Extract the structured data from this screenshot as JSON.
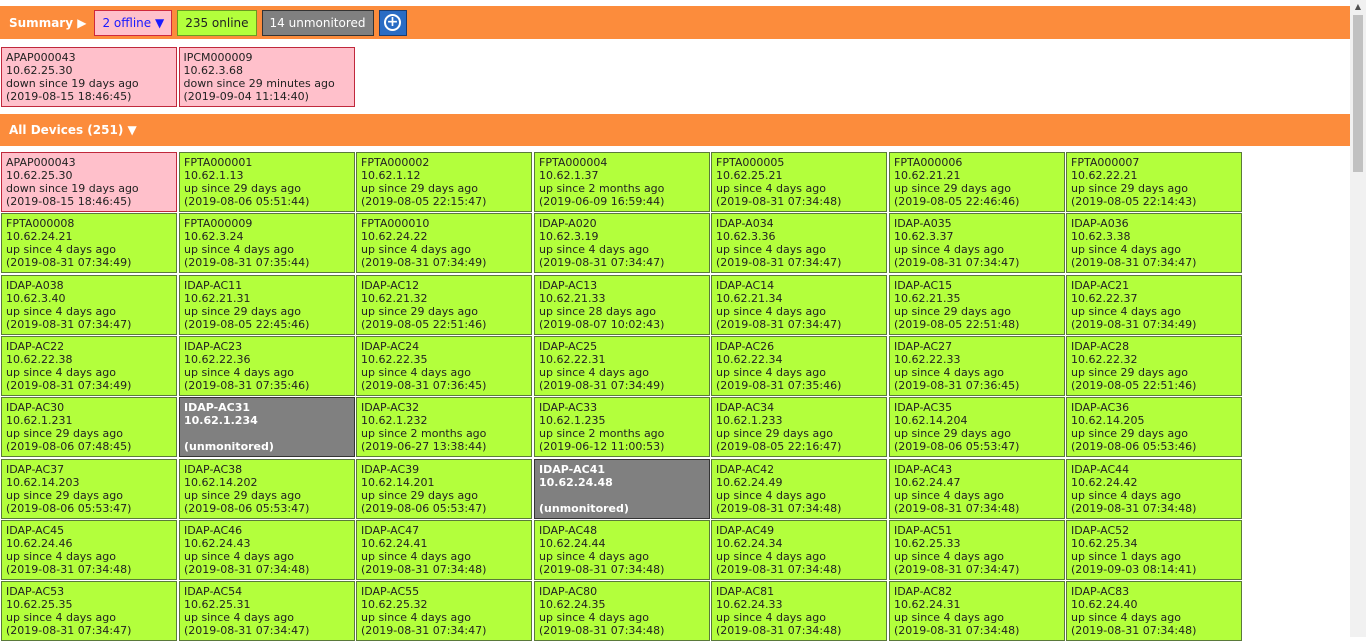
{
  "summary": {
    "title": "Summary ▶",
    "offline_label": "2 offline ▼",
    "online_label": "235 online",
    "unmonitored_label": "14 unmonitored",
    "add_symbol": "+"
  },
  "offline_devices": [
    {
      "name": "APAP000043",
      "ip": "10.62.25.30",
      "status": "down since 19 days ago",
      "since": "(2019-08-15 18:46:45)"
    },
    {
      "name": "IPCM000009",
      "ip": "10.62.3.68",
      "status": "down since 29 minutes ago",
      "since": "(2019-09-04 11:14:40)"
    }
  ],
  "all_devices_title": "All Devices (251) ▼",
  "colors": {
    "header_bar": "#fc8c3c",
    "online": "#b3ff3c",
    "offline": "#ffc0cb",
    "unmonitored": "#808080",
    "add_button": "#2a6cc4"
  },
  "devices": [
    {
      "state": "offline",
      "name": "APAP000043",
      "ip": "10.62.25.30",
      "status": "down since 19 days ago",
      "since": "(2019-08-15 18:46:45)"
    },
    {
      "state": "online",
      "name": "FPTA000001",
      "ip": "10.62.1.13",
      "status": "up since 29 days ago",
      "since": "(2019-08-06 05:51:44)"
    },
    {
      "state": "online",
      "name": "FPTA000002",
      "ip": "10.62.1.12",
      "status": "up since 29 days ago",
      "since": "(2019-08-05 22:15:47)"
    },
    {
      "state": "online",
      "name": "FPTA000004",
      "ip": "10.62.1.37",
      "status": "up since 2 months ago",
      "since": "(2019-06-09 16:59:44)"
    },
    {
      "state": "online",
      "name": "FPTA000005",
      "ip": "10.62.25.21",
      "status": "up since 4 days ago",
      "since": "(2019-08-31 07:34:48)"
    },
    {
      "state": "online",
      "name": "FPTA000006",
      "ip": "10.62.21.21",
      "status": "up since 29 days ago",
      "since": "(2019-08-05 22:46:46)"
    },
    {
      "state": "online",
      "name": "FPTA000007",
      "ip": "10.62.22.21",
      "status": "up since 29 days ago",
      "since": "(2019-08-05 22:14:43)"
    },
    {
      "state": "online",
      "name": "FPTA000008",
      "ip": "10.62.24.21",
      "status": "up since 4 days ago",
      "since": "(2019-08-31 07:34:49)"
    },
    {
      "state": "online",
      "name": "FPTA000009",
      "ip": "10.62.3.24",
      "status": "up since 4 days ago",
      "since": "(2019-08-31 07:35:44)"
    },
    {
      "state": "online",
      "name": "FPTA000010",
      "ip": "10.62.24.22",
      "status": "up since 4 days ago",
      "since": "(2019-08-31 07:34:49)"
    },
    {
      "state": "online",
      "name": "IDAP-A020",
      "ip": "10.62.3.19",
      "status": "up since 4 days ago",
      "since": "(2019-08-31 07:34:47)"
    },
    {
      "state": "online",
      "name": "IDAP-A034",
      "ip": "10.62.3.36",
      "status": "up since 4 days ago",
      "since": "(2019-08-31 07:34:47)"
    },
    {
      "state": "online",
      "name": "IDAP-A035",
      "ip": "10.62.3.37",
      "status": "up since 4 days ago",
      "since": "(2019-08-31 07:34:47)"
    },
    {
      "state": "online",
      "name": "IDAP-A036",
      "ip": "10.62.3.38",
      "status": "up since 4 days ago",
      "since": "(2019-08-31 07:34:47)"
    },
    {
      "state": "online",
      "name": "IDAP-A038",
      "ip": "10.62.3.40",
      "status": "up since 4 days ago",
      "since": "(2019-08-31 07:34:47)"
    },
    {
      "state": "online",
      "name": "IDAP-AC11",
      "ip": "10.62.21.31",
      "status": "up since 29 days ago",
      "since": "(2019-08-05 22:45:46)"
    },
    {
      "state": "online",
      "name": "IDAP-AC12",
      "ip": "10.62.21.32",
      "status": "up since 29 days ago",
      "since": "(2019-08-05 22:51:46)"
    },
    {
      "state": "online",
      "name": "IDAP-AC13",
      "ip": "10.62.21.33",
      "status": "up since 28 days ago",
      "since": "(2019-08-07 10:02:43)"
    },
    {
      "state": "online",
      "name": "IDAP-AC14",
      "ip": "10.62.21.34",
      "status": "up since 4 days ago",
      "since": "(2019-08-31 07:34:47)"
    },
    {
      "state": "online",
      "name": "IDAP-AC15",
      "ip": "10.62.21.35",
      "status": "up since 29 days ago",
      "since": "(2019-08-05 22:51:48)"
    },
    {
      "state": "online",
      "name": "IDAP-AC21",
      "ip": "10.62.22.37",
      "status": "up since 4 days ago",
      "since": "(2019-08-31 07:34:49)"
    },
    {
      "state": "online",
      "name": "IDAP-AC22",
      "ip": "10.62.22.38",
      "status": "up since 4 days ago",
      "since": "(2019-08-31 07:34:49)"
    },
    {
      "state": "online",
      "name": "IDAP-AC23",
      "ip": "10.62.22.36",
      "status": "up since 4 days ago",
      "since": "(2019-08-31 07:35:46)"
    },
    {
      "state": "online",
      "name": "IDAP-AC24",
      "ip": "10.62.22.35",
      "status": "up since 4 days ago",
      "since": "(2019-08-31 07:36:45)"
    },
    {
      "state": "online",
      "name": "IDAP-AC25",
      "ip": "10.62.22.31",
      "status": "up since 4 days ago",
      "since": "(2019-08-31 07:34:49)"
    },
    {
      "state": "online",
      "name": "IDAP-AC26",
      "ip": "10.62.22.34",
      "status": "up since 4 days ago",
      "since": "(2019-08-31 07:35:46)"
    },
    {
      "state": "online",
      "name": "IDAP-AC27",
      "ip": "10.62.22.33",
      "status": "up since 4 days ago",
      "since": "(2019-08-31 07:36:45)"
    },
    {
      "state": "online",
      "name": "IDAP-AC28",
      "ip": "10.62.22.32",
      "status": "up since 29 days ago",
      "since": "(2019-08-05 22:51:46)"
    },
    {
      "state": "online",
      "name": "IDAP-AC30",
      "ip": "10.62.1.231",
      "status": "up since 29 days ago",
      "since": "(2019-08-06 07:48:45)"
    },
    {
      "state": "unmonitored",
      "name": "IDAP-AC31",
      "ip": "10.62.1.234",
      "status": "",
      "since": "(unmonitored)"
    },
    {
      "state": "online",
      "name": "IDAP-AC32",
      "ip": "10.62.1.232",
      "status": "up since 2 months ago",
      "since": "(2019-06-27 13:38:44)"
    },
    {
      "state": "online",
      "name": "IDAP-AC33",
      "ip": "10.62.1.235",
      "status": "up since 2 months ago",
      "since": "(2019-06-12 11:00:53)"
    },
    {
      "state": "online",
      "name": "IDAP-AC34",
      "ip": "10.62.1.233",
      "status": "up since 29 days ago",
      "since": "(2019-08-05 22:16:47)"
    },
    {
      "state": "online",
      "name": "IDAP-AC35",
      "ip": "10.62.14.204",
      "status": "up since 29 days ago",
      "since": "(2019-08-06 05:53:47)"
    },
    {
      "state": "online",
      "name": "IDAP-AC36",
      "ip": "10.62.14.205",
      "status": "up since 29 days ago",
      "since": "(2019-08-06 05:53:46)"
    },
    {
      "state": "online",
      "name": "IDAP-AC37",
      "ip": "10.62.14.203",
      "status": "up since 29 days ago",
      "since": "(2019-08-06 05:53:47)"
    },
    {
      "state": "online",
      "name": "IDAP-AC38",
      "ip": "10.62.14.202",
      "status": "up since 29 days ago",
      "since": "(2019-08-06 05:53:47)"
    },
    {
      "state": "online",
      "name": "IDAP-AC39",
      "ip": "10.62.14.201",
      "status": "up since 29 days ago",
      "since": "(2019-08-06 05:53:47)"
    },
    {
      "state": "unmonitored",
      "name": "IDAP-AC41",
      "ip": "10.62.24.48",
      "status": "",
      "since": "(unmonitored)"
    },
    {
      "state": "online",
      "name": "IDAP-AC42",
      "ip": "10.62.24.49",
      "status": "up since 4 days ago",
      "since": "(2019-08-31 07:34:48)"
    },
    {
      "state": "online",
      "name": "IDAP-AC43",
      "ip": "10.62.24.47",
      "status": "up since 4 days ago",
      "since": "(2019-08-31 07:34:48)"
    },
    {
      "state": "online",
      "name": "IDAP-AC44",
      "ip": "10.62.24.42",
      "status": "up since 4 days ago",
      "since": "(2019-08-31 07:34:48)"
    },
    {
      "state": "online",
      "name": "IDAP-AC45",
      "ip": "10.62.24.46",
      "status": "up since 4 days ago",
      "since": "(2019-08-31 07:34:48)"
    },
    {
      "state": "online",
      "name": "IDAP-AC46",
      "ip": "10.62.24.43",
      "status": "up since 4 days ago",
      "since": "(2019-08-31 07:34:48)"
    },
    {
      "state": "online",
      "name": "IDAP-AC47",
      "ip": "10.62.24.41",
      "status": "up since 4 days ago",
      "since": "(2019-08-31 07:34:48)"
    },
    {
      "state": "online",
      "name": "IDAP-AC48",
      "ip": "10.62.24.44",
      "status": "up since 4 days ago",
      "since": "(2019-08-31 07:34:48)"
    },
    {
      "state": "online",
      "name": "IDAP-AC49",
      "ip": "10.62.24.34",
      "status": "up since 4 days ago",
      "since": "(2019-08-31 07:34:48)"
    },
    {
      "state": "online",
      "name": "IDAP-AC51",
      "ip": "10.62.25.33",
      "status": "up since 4 days ago",
      "since": "(2019-08-31 07:34:47)"
    },
    {
      "state": "online",
      "name": "IDAP-AC52",
      "ip": "10.62.25.34",
      "status": "up since 1 days ago",
      "since": "(2019-09-03 08:14:41)"
    },
    {
      "state": "online",
      "name": "IDAP-AC53",
      "ip": "10.62.25.35",
      "status": "up since 4 days ago",
      "since": "(2019-08-31 07:34:47)"
    },
    {
      "state": "online",
      "name": "IDAP-AC54",
      "ip": "10.62.25.31",
      "status": "up since 4 days ago",
      "since": "(2019-08-31 07:34:47)"
    },
    {
      "state": "online",
      "name": "IDAP-AC55",
      "ip": "10.62.25.32",
      "status": "up since 4 days ago",
      "since": "(2019-08-31 07:34:47)"
    },
    {
      "state": "online",
      "name": "IDAP-AC80",
      "ip": "10.62.24.35",
      "status": "up since 4 days ago",
      "since": "(2019-08-31 07:34:48)"
    },
    {
      "state": "online",
      "name": "IDAP-AC81",
      "ip": "10.62.24.33",
      "status": "up since 4 days ago",
      "since": "(2019-08-31 07:34:48)"
    },
    {
      "state": "online",
      "name": "IDAP-AC82",
      "ip": "10.62.24.31",
      "status": "up since 4 days ago",
      "since": "(2019-08-31 07:34:48)"
    },
    {
      "state": "online",
      "name": "IDAP-AC83",
      "ip": "10.62.24.40",
      "status": "up since 4 days ago",
      "since": "(2019-08-31 07:34:48)"
    }
  ]
}
